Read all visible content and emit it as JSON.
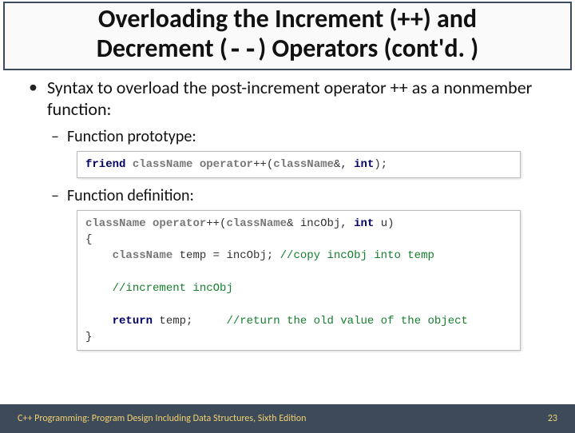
{
  "title_line1": "Overloading the Increment (++) and",
  "title_line2": "Decrement (--) Operators (cont'd. )",
  "bullet_main": "Syntax to overload the post-increment operator ++ as a nonmember function:",
  "sub_prototype": "Function prototype:",
  "sub_definition": "Function definition:",
  "code_prototype_plain": "friend className operator++(className&, int);",
  "code_definition_plain": "className operator++(className& incObj, int u)\n{\n    className temp = incObj; //copy incObj into temp\n\n    //increment incObj\n\n    return temp;     //return the old value of the object\n}",
  "footer_left": "C++ Programming: Program Design Including Data Structures, Sixth Edition",
  "footer_right": "23"
}
